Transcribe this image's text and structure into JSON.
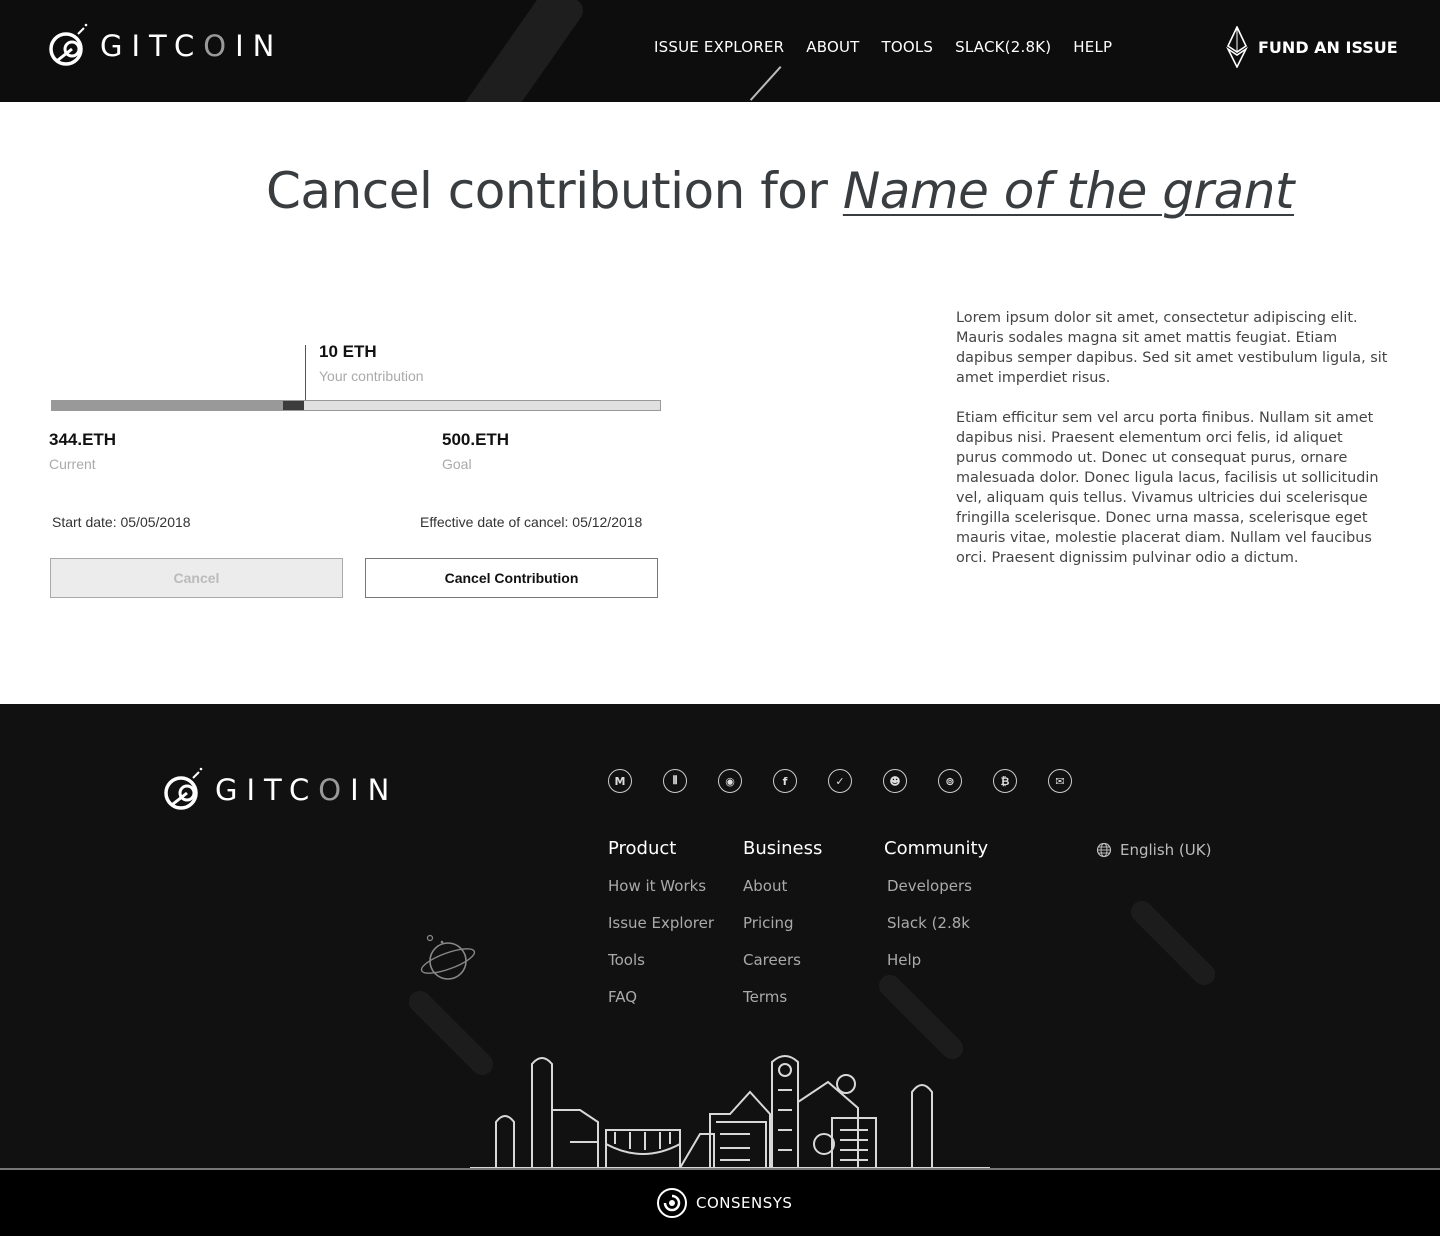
{
  "brand": {
    "name_prefix": "GITC",
    "name_o": "O",
    "name_suffix": "IN"
  },
  "nav": {
    "items": [
      "ISSUE EXPLORER",
      "ABOUT",
      "TOOLS",
      "SLACK(2.8K)",
      "HELP"
    ],
    "cta_label": "FUND AN ISSUE",
    "cta_icon": "ethereum-icon"
  },
  "page": {
    "title_prefix": "Cancel contribution for ",
    "grant_name": "Name of the grant"
  },
  "progress": {
    "current_fraction": 0.38,
    "contribution_fraction": 0.035,
    "contribution_amount": "10 ETH",
    "contribution_label": "Your contribution",
    "current_value": "344.ETH",
    "current_label": "Current",
    "goal_value": "500.ETH",
    "goal_label": "Goal"
  },
  "dates": {
    "start": "Start date: 05/05/2018",
    "cancel": "Effective date of cancel: 05/12/2018"
  },
  "actions": {
    "cancel_label": "Cancel",
    "confirm_label": "Cancel Contribution"
  },
  "description": {
    "para1": "Lorem ipsum dolor sit amet, consectetur adipiscing elit. Mauris sodales magna sit amet mattis feugiat. Etiam dapibus semper dapibus. Sed sit amet vestibulum ligula, sit amet imperdiet risus.",
    "para2": " Etiam efficitur sem vel arcu porta finibus. Nullam sit amet dapibus nisi. Praesent elementum orci felis, id aliquet purus commodo ut. Donec ut consequat purus, ornare malesuada dolor. Donec ligula lacus, facilisis ut sollicitudin vel, aliquam quis tellus. Vivamus ultricies dui scelerisque fringilla scelerisque. Donec urna massa, scelerisque eget mauris vitae, molestie placerat diam. Nullam vel faucibus orci. Praesent dignissim pulvinar odio a dictum."
  },
  "footer": {
    "social_icons": [
      {
        "name": "medium-icon",
        "glyph": "M"
      },
      {
        "name": "gitter-icon",
        "glyph": "⦀"
      },
      {
        "name": "github-icon",
        "glyph": "◉"
      },
      {
        "name": "facebook-icon",
        "glyph": "f"
      },
      {
        "name": "twitter-icon",
        "glyph": "✓"
      },
      {
        "name": "reddit-icon",
        "glyph": "☻"
      },
      {
        "name": "discord-icon",
        "glyph": "⊚"
      },
      {
        "name": "bitcoin-icon",
        "glyph": "₿"
      },
      {
        "name": "email-icon",
        "glyph": "✉"
      }
    ],
    "columns": [
      {
        "heading": "Product",
        "links": [
          "How it Works",
          "Issue Explorer",
          "Tools",
          "FAQ"
        ]
      },
      {
        "heading": "Business",
        "links": [
          "About",
          "Pricing",
          "Careers",
          "Terms"
        ]
      },
      {
        "heading": "Community",
        "links": [
          "Developers",
          "Slack (2.8k",
          "Help"
        ]
      }
    ],
    "language": "English (UK)",
    "consensys": "CONSENSYS"
  }
}
